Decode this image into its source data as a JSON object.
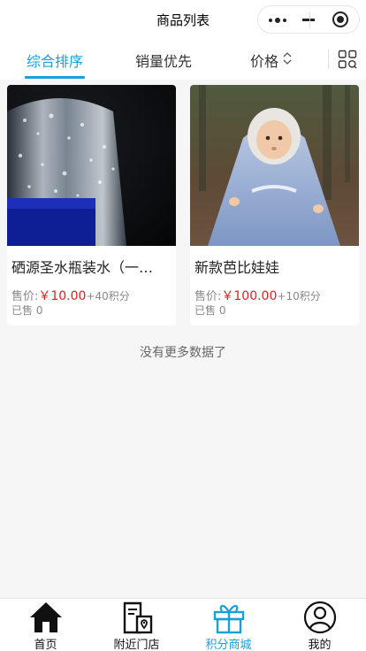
{
  "header": {
    "title": "商品列表"
  },
  "tabs": [
    {
      "label": "综合排序",
      "active": true
    },
    {
      "label": "销量优先",
      "active": false
    },
    {
      "label": "价格",
      "active": false
    }
  ],
  "products": [
    {
      "name": "硒源圣水瓶装水（一…",
      "price_prefix": "售价:",
      "price": "￥10.00",
      "points": "+40积分",
      "sold": "已售 0"
    },
    {
      "name": "新款芭比娃娃",
      "price_prefix": "售价:",
      "price": "￥100.00",
      "points": "+10积分",
      "sold": "已售 0"
    }
  ],
  "no_more_text": "没有更多数据了",
  "tabbar": [
    {
      "label": "首页",
      "icon": "home-icon",
      "active": false
    },
    {
      "label": "附近门店",
      "icon": "store-location-icon",
      "active": false
    },
    {
      "label": "积分商城",
      "icon": "gift-icon",
      "active": true
    },
    {
      "label": "我的",
      "icon": "user-icon",
      "active": false
    }
  ],
  "colors": {
    "accent": "#1aa0d8",
    "price": "#e02020"
  }
}
